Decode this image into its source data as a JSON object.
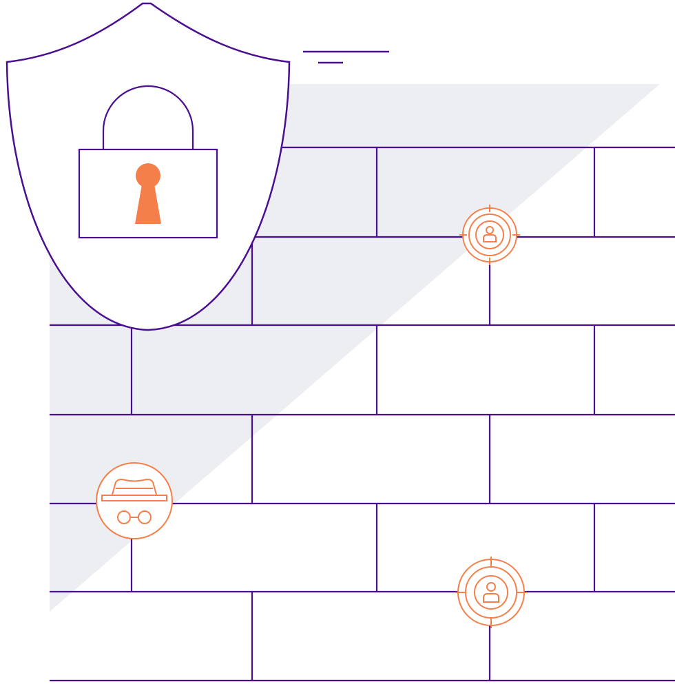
{
  "illustration": {
    "subject": "security-firewall",
    "colors": {
      "background": "#ffffff",
      "line": "#4a0e91",
      "accent": "#f47f4a",
      "shadow": "#eceef2"
    },
    "icons": [
      {
        "name": "shield-icon"
      },
      {
        "name": "padlock-icon"
      },
      {
        "name": "keyhole-icon"
      },
      {
        "name": "target-user-icon"
      },
      {
        "name": "incognito-spy-icon"
      }
    ]
  }
}
